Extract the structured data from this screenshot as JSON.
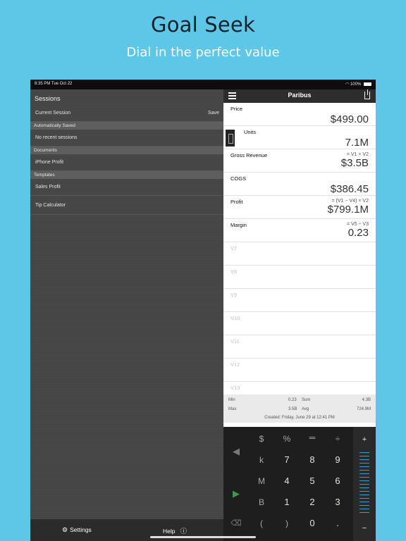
{
  "promo": {
    "title": "Goal Seek",
    "subtitle": "Dial in the perfect value"
  },
  "status_bar": {
    "time": "8:35 PM  Tue Oct 22",
    "battery": "100%"
  },
  "sidebar": {
    "title": "Sessions",
    "current_session": {
      "label": "Current Session",
      "action": "Save"
    },
    "sections": {
      "auto_saved": "Automatically Saved",
      "documents": "Documents",
      "templates": "Templates"
    },
    "no_recent": "No recent sessions",
    "documents": [
      "iPhone Profit"
    ],
    "templates": [
      "Sales Profit",
      "Tip Calculator"
    ],
    "footer": {
      "settings": "Settings",
      "help": "Help"
    }
  },
  "panel": {
    "app_title": "Paribus",
    "rows": [
      {
        "name": "Price",
        "value": "$499.00",
        "formula": ""
      },
      {
        "name": "Units",
        "value": "7.1M",
        "formula": ""
      },
      {
        "name": "Gross Revenue",
        "value": "$3.5B",
        "formula": [
          "= V1 ",
          "×",
          " V2"
        ]
      },
      {
        "name": "COGS",
        "value": "$386.45",
        "formula": ""
      },
      {
        "name": "Profit",
        "value": "$799.1M",
        "formula": [
          "= (V1 ",
          "−",
          " V4) ",
          "×",
          " V2"
        ]
      },
      {
        "name": "Margin",
        "value": "0.23",
        "formula": [
          "= V5 ",
          "÷",
          " V3"
        ]
      },
      {
        "name": "V7"
      },
      {
        "name": "V8"
      },
      {
        "name": "V9"
      },
      {
        "name": "V10"
      },
      {
        "name": "V11"
      },
      {
        "name": "V12"
      },
      {
        "name": "V13"
      }
    ],
    "stats": {
      "min_label": "Min",
      "min_value": "0.23",
      "sum_label": "Sum",
      "sum_value": "4.3B",
      "max_label": "Max",
      "max_value": "3.5B",
      "avg_label": "Avg",
      "avg_value": "724.9M",
      "created": "Created:  Friday, June 29 at 12:41 PM"
    }
  },
  "keypad": {
    "row1": [
      "$",
      "%",
      "÷"
    ],
    "row2": [
      "k",
      "7",
      "8",
      "9"
    ],
    "row3": [
      "M",
      "4",
      "5",
      "6"
    ],
    "row4": [
      "B",
      "1",
      "2",
      "3"
    ],
    "row5": [
      "(",
      ")",
      "0",
      "."
    ],
    "plus": "+",
    "minus": "−"
  },
  "colors": {
    "background": "#5ec6e6",
    "formula_operator": "#3a6bd0",
    "slider_accent": "#2a9fd0"
  }
}
